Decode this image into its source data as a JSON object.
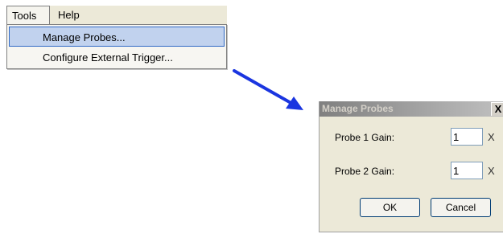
{
  "menubar": {
    "tools_label": "Tools",
    "help_label": "Help"
  },
  "tools_menu": {
    "items": [
      {
        "label": "Manage Probes..."
      },
      {
        "label": "Configure External Trigger..."
      }
    ]
  },
  "arrow": {
    "color": "#1a35e0"
  },
  "dialog": {
    "title": "Manage Probes",
    "close_glyph": "X",
    "probe1": {
      "label": "Probe 1 Gain:",
      "value": "1",
      "unit": "X"
    },
    "probe2": {
      "label": "Probe 2 Gain:",
      "value": "1",
      "unit": "X"
    },
    "ok_label": "OK",
    "cancel_label": "Cancel"
  }
}
